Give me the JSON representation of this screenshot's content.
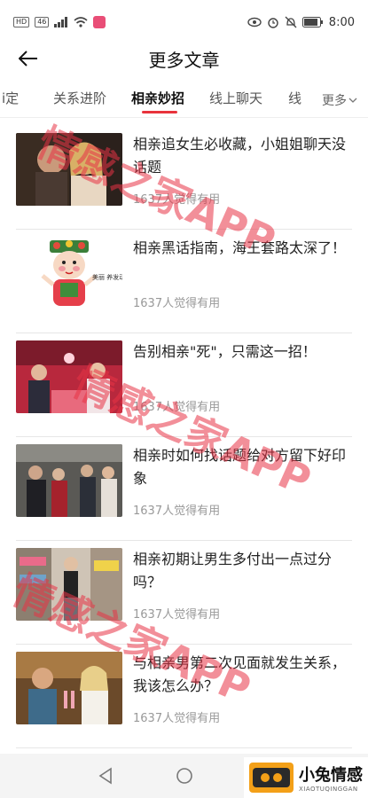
{
  "status_bar": {
    "left_badge_1": "HD",
    "left_badge_2": "46",
    "time": "8:00"
  },
  "nav": {
    "title": "更多文章"
  },
  "tabs": {
    "items": [
      {
        "label": "i定"
      },
      {
        "label": "关系进阶"
      },
      {
        "label": "相亲妙招"
      },
      {
        "label": "线上聊天"
      },
      {
        "label": "线"
      }
    ],
    "active_index": 2,
    "more_label": "更多"
  },
  "articles": [
    {
      "title": "相亲追女生必收藏，小姐姐聊天没话题",
      "meta": "1637人觉得有用",
      "thumb_icon": "couple-photo"
    },
    {
      "title": "相亲黑话指南，海王套路太深了！",
      "meta": "1637人觉得有用",
      "thumb_icon": "cartoon-opera-girl"
    },
    {
      "title": "告别相亲\"死\"，只需这一招！",
      "meta": "1637人觉得有用",
      "thumb_icon": "dating-event-photo"
    },
    {
      "title": "相亲时如何找话题给对方留下好印象",
      "meta": "1637人觉得有用",
      "thumb_icon": "speed-dating-photo"
    },
    {
      "title": "相亲初期让男生多付出一点过分吗？",
      "meta": "1637人觉得有用",
      "thumb_icon": "shopping-photo"
    },
    {
      "title": "与相亲男第二次见面就发生关系，我该怎么办？",
      "meta": "1637人觉得有用",
      "thumb_icon": "dinner-photo"
    }
  ],
  "thumb2_text": "美丽 养发动了",
  "watermarks": [
    "情感之家APP",
    "情感之家APP",
    "情感之家APP"
  ],
  "corner_logo": {
    "main": "小兔情感",
    "sub": "XIAOTUQINGGAN"
  },
  "colors": {
    "accent": "#e8333c",
    "watermark": "#e83346"
  }
}
